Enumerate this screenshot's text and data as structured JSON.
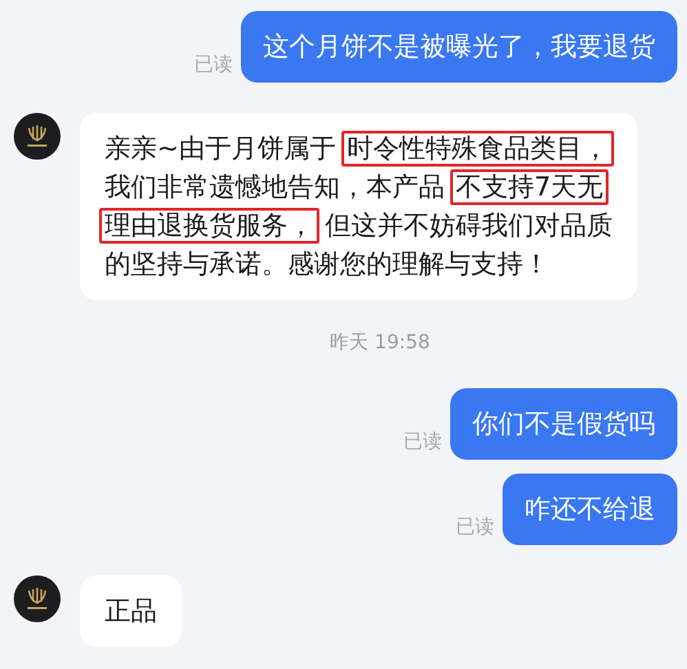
{
  "messages": [
    {
      "kind": "sent",
      "text": "这个月饼不是被曝光了，我要退货",
      "status": "已读"
    },
    {
      "kind": "received",
      "lines": [
        [
          {
            "text": "亲亲~由于月饼属于",
            "highlighted": false
          },
          {
            "text": "时令性特殊食品类目，",
            "highlighted": true
          }
        ],
        [
          {
            "text": "我们非常遗憾地告知，本产品",
            "highlighted": false
          },
          {
            "text": "不支持7天无",
            "highlighted": true
          }
        ],
        [
          {
            "text": "理由退换货服务，",
            "highlighted": true
          },
          {
            "text": "但这并不妨碍我们对品质",
            "highlighted": false
          }
        ],
        [
          {
            "text": "的坚持与承诺。感谢您的理解与支持！",
            "highlighted": false
          }
        ]
      ]
    },
    {
      "kind": "time",
      "text": "昨天 19:58"
    },
    {
      "kind": "sent",
      "text": "你们不是假货吗",
      "status": "已读"
    },
    {
      "kind": "sent",
      "text": "咋还不给退",
      "status": "已读"
    },
    {
      "kind": "received",
      "lines": [
        [
          {
            "text": "正品",
            "highlighted": false
          }
        ]
      ]
    }
  ]
}
